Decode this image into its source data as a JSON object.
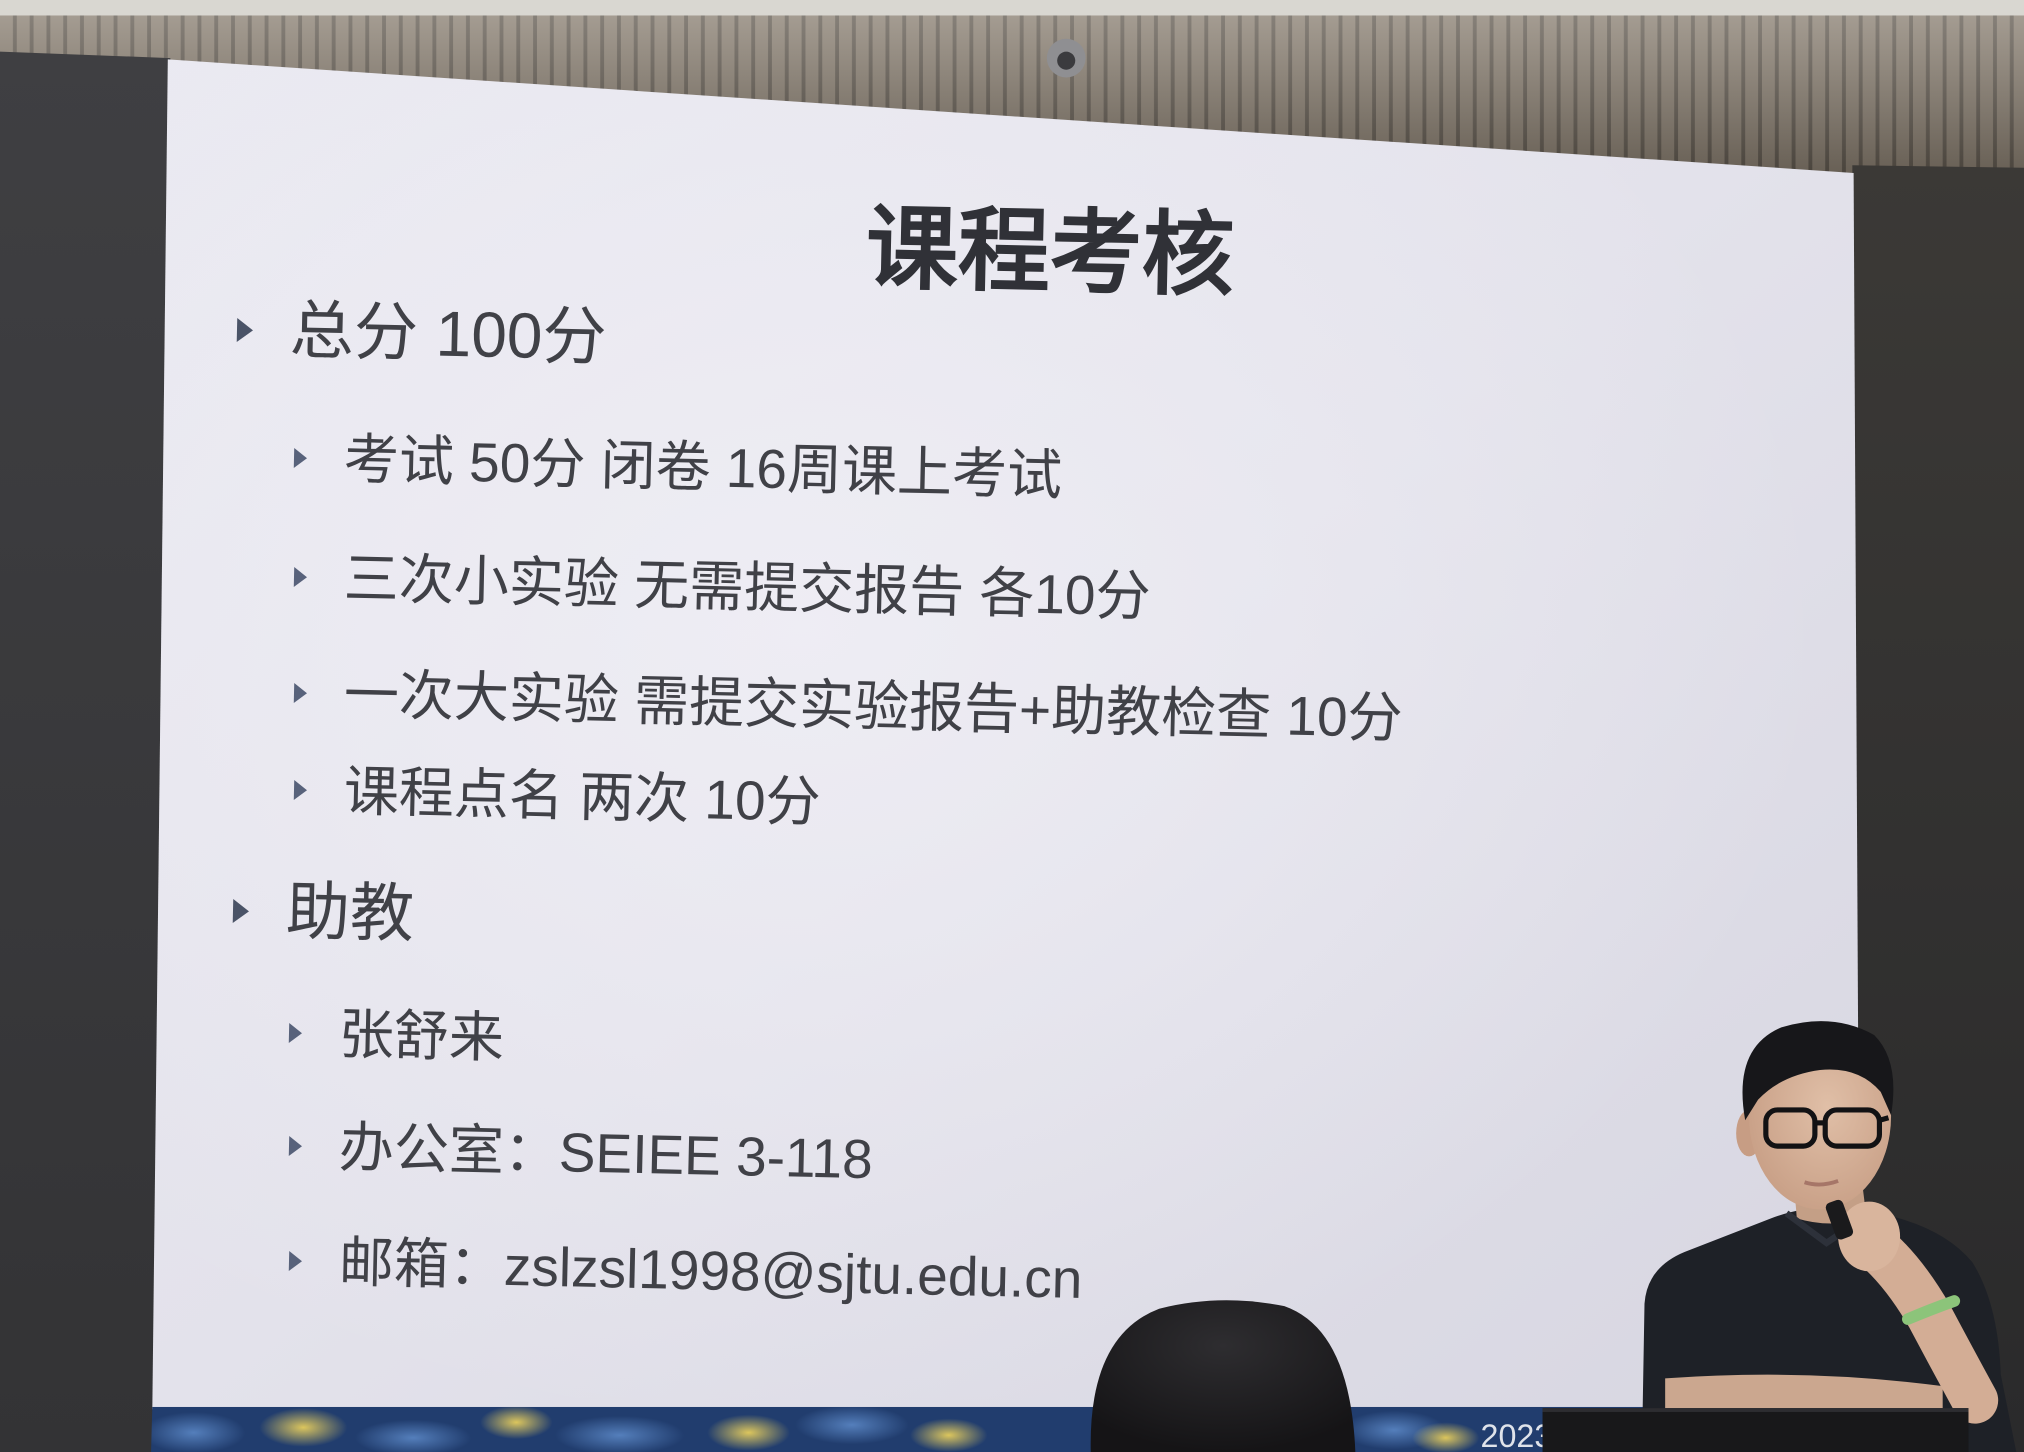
{
  "slide": {
    "title": "课程考核",
    "sections": [
      {
        "label": "总分 100分",
        "items": [
          "考试 50分 闭卷 16周课上考试",
          "三次小实验 无需提交报告 各10分",
          "一次大实验 需提交实验报告+助教检查 10分",
          "课程点名 两次 10分"
        ]
      },
      {
        "label": "助教",
        "items": [
          "张舒来",
          "办公室：SEIEE 3-118",
          "邮箱：zslzsl1998@sjtu.edu.cn"
        ]
      }
    ],
    "footer_year": "2023",
    "bullet_icon": "triangle-right-icon"
  },
  "colors": {
    "slide_background": "#e4e3ec",
    "body_text": "#404147",
    "title_text": "#303137",
    "bullet": "#4a5367",
    "footer_banner": "#213d6e",
    "wall": "#3a3a3c",
    "wood_slats": "#857a6c"
  }
}
